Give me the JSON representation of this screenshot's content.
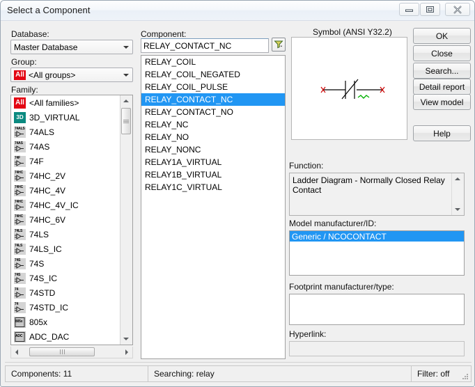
{
  "window": {
    "title": "Select a Component",
    "controls": {
      "minimize": "minimize-icon",
      "restore": "restore-icon",
      "close": "close-icon"
    }
  },
  "left_panel": {
    "database_label": "Database:",
    "database_value": "Master Database",
    "group_label": "Group:",
    "group_badge": "All",
    "group_value": "<All groups>",
    "family_label": "Family:",
    "family_items": [
      {
        "label": "<All families>",
        "icon": "all-badge-icon",
        "icon_text": "All",
        "icon_kind": "redall"
      },
      {
        "label": "3D_VIRTUAL",
        "icon": "3d-virtual-icon",
        "icon_text": "3D",
        "icon_kind": "teal"
      },
      {
        "label": "74ALS",
        "icon": "logic-gate-icon",
        "icon_text": "74ALS",
        "icon_kind": "gate"
      },
      {
        "label": "74AS",
        "icon": "logic-gate-icon",
        "icon_text": "74AS",
        "icon_kind": "gate"
      },
      {
        "label": "74F",
        "icon": "logic-gate-icon",
        "icon_text": "74F",
        "icon_kind": "gate"
      },
      {
        "label": "74HC_2V",
        "icon": "logic-gate-icon",
        "icon_text": "74HC",
        "icon_kind": "gate"
      },
      {
        "label": "74HC_4V",
        "icon": "logic-gate-icon",
        "icon_text": "74HC",
        "icon_kind": "gate"
      },
      {
        "label": "74HC_4V_IC",
        "icon": "logic-gate-icon",
        "icon_text": "74HC",
        "icon_kind": "gate"
      },
      {
        "label": "74HC_6V",
        "icon": "logic-gate-icon",
        "icon_text": "74HC",
        "icon_kind": "gate"
      },
      {
        "label": "74LS",
        "icon": "logic-gate-icon",
        "icon_text": "74LS",
        "icon_kind": "gate"
      },
      {
        "label": "74LS_IC",
        "icon": "logic-gate-icon",
        "icon_text": "74LS",
        "icon_kind": "gate"
      },
      {
        "label": "74S",
        "icon": "logic-gate-icon",
        "icon_text": "74S",
        "icon_kind": "gate"
      },
      {
        "label": "74S_IC",
        "icon": "logic-gate-icon",
        "icon_text": "74S",
        "icon_kind": "gate"
      },
      {
        "label": "74STD",
        "icon": "logic-gate-icon",
        "icon_text": "74",
        "icon_kind": "gate"
      },
      {
        "label": "74STD_IC",
        "icon": "logic-gate-icon",
        "icon_text": "74",
        "icon_kind": "gate"
      },
      {
        "label": "805x",
        "icon": "mcu-icon",
        "icon_text": "805x",
        "icon_kind": "grey"
      },
      {
        "label": "ADC_DAC",
        "icon": "adc-dac-icon",
        "icon_text": "ADC",
        "icon_kind": "grey"
      }
    ]
  },
  "component_panel": {
    "label": "Component:",
    "search_value": "RELAY_CONTACT_NC",
    "filter_icon": "filter-funnel-icon",
    "items": [
      "RELAY_COIL",
      "RELAY_COIL_NEGATED",
      "RELAY_COIL_PULSE",
      "RELAY_CONTACT_NC",
      "RELAY_CONTACT_NO",
      "RELAY_NC",
      "RELAY_NO",
      "RELAY_NONC",
      "RELAY1A_VIRTUAL",
      "RELAY1B_VIRTUAL",
      "RELAY1C_VIRTUAL"
    ],
    "selected_index": 3
  },
  "details_panel": {
    "symbol_label": "Symbol (ANSI Y32.2)",
    "symbol_icon": "relay-contact-nc-symbol",
    "function_label": "Function:",
    "function_text": "Ladder Diagram - Normally Closed Relay Contact",
    "model_label": "Model manufacturer/ID:",
    "model_value": "Generic / NCOCONTACT",
    "footprint_label": "Footprint manufacturer/type:",
    "footprint_value": "",
    "hyperlink_label": "Hyperlink:",
    "hyperlink_value": ""
  },
  "buttons": {
    "ok": "OK",
    "close": "Close",
    "search": "Search...",
    "detail_report": "Detail report",
    "view_model": "View model",
    "help": "Help"
  },
  "statusbar": {
    "components": "Components: 11",
    "searching": "Searching: relay",
    "filter": "Filter: off"
  },
  "colors": {
    "selection_blue": "#2196f3",
    "badge_red": "#e30613",
    "symbol_pin_red": "#cc0000",
    "symbol_wire_green": "#00b000",
    "teal_icon": "#0b8a80"
  }
}
